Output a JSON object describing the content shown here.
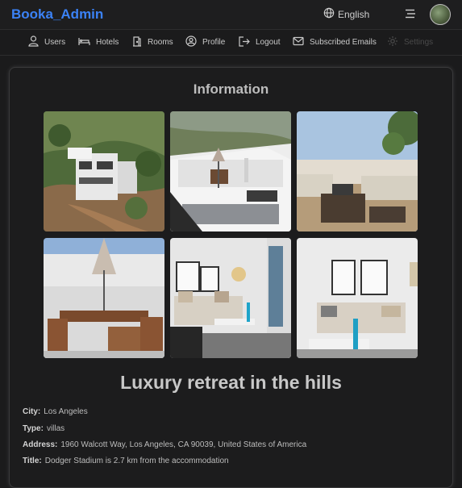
{
  "header": {
    "brand": "Booka_Admin",
    "language": "English",
    "icons": [
      "globe-icon",
      "moon-icon",
      "menu-icon",
      "avatar"
    ]
  },
  "nav": {
    "items": [
      {
        "label": "Users",
        "icon": "user-icon"
      },
      {
        "label": "Hotels",
        "icon": "bed-icon"
      },
      {
        "label": "Rooms",
        "icon": "door-icon"
      },
      {
        "label": "Profile",
        "icon": "profile-circle-icon"
      },
      {
        "label": "Logout",
        "icon": "logout-icon"
      },
      {
        "label": "Subscribed Emails",
        "icon": "mail-icon"
      },
      {
        "label": "Settings",
        "icon": "gear-icon",
        "disabled": true
      }
    ]
  },
  "main": {
    "title": "Information",
    "hotel_name": "Luxury retreat in the hills",
    "details": [
      {
        "label": "City:",
        "value": "Los Angeles"
      },
      {
        "label": "Type:",
        "value": "villas"
      },
      {
        "label": "Address:",
        "value": "1960 Walcott Way, Los Angeles, CA 90039, United States of America"
      },
      {
        "label": "Title:",
        "value": "Dodger Stadium is 2.7 km from the accommodation"
      }
    ]
  },
  "colors": {
    "brand": "#3b82f6",
    "background": "#1b1b1c"
  }
}
